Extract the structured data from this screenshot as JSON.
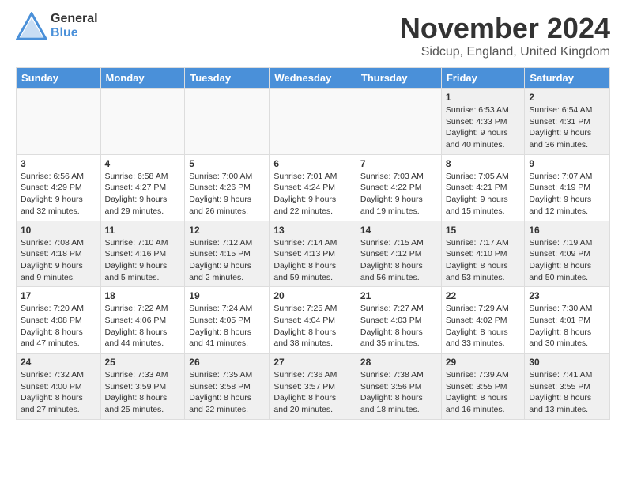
{
  "header": {
    "logo_general": "General",
    "logo_blue": "Blue",
    "month_title": "November 2024",
    "location": "Sidcup, England, United Kingdom"
  },
  "days_of_week": [
    "Sunday",
    "Monday",
    "Tuesday",
    "Wednesday",
    "Thursday",
    "Friday",
    "Saturday"
  ],
  "weeks": [
    [
      {
        "date": "",
        "info": ""
      },
      {
        "date": "",
        "info": ""
      },
      {
        "date": "",
        "info": ""
      },
      {
        "date": "",
        "info": ""
      },
      {
        "date": "",
        "info": ""
      },
      {
        "date": "1",
        "info": "Sunrise: 6:53 AM\nSunset: 4:33 PM\nDaylight: 9 hours and 40 minutes."
      },
      {
        "date": "2",
        "info": "Sunrise: 6:54 AM\nSunset: 4:31 PM\nDaylight: 9 hours and 36 minutes."
      }
    ],
    [
      {
        "date": "3",
        "info": "Sunrise: 6:56 AM\nSunset: 4:29 PM\nDaylight: 9 hours and 32 minutes."
      },
      {
        "date": "4",
        "info": "Sunrise: 6:58 AM\nSunset: 4:27 PM\nDaylight: 9 hours and 29 minutes."
      },
      {
        "date": "5",
        "info": "Sunrise: 7:00 AM\nSunset: 4:26 PM\nDaylight: 9 hours and 26 minutes."
      },
      {
        "date": "6",
        "info": "Sunrise: 7:01 AM\nSunset: 4:24 PM\nDaylight: 9 hours and 22 minutes."
      },
      {
        "date": "7",
        "info": "Sunrise: 7:03 AM\nSunset: 4:22 PM\nDaylight: 9 hours and 19 minutes."
      },
      {
        "date": "8",
        "info": "Sunrise: 7:05 AM\nSunset: 4:21 PM\nDaylight: 9 hours and 15 minutes."
      },
      {
        "date": "9",
        "info": "Sunrise: 7:07 AM\nSunset: 4:19 PM\nDaylight: 9 hours and 12 minutes."
      }
    ],
    [
      {
        "date": "10",
        "info": "Sunrise: 7:08 AM\nSunset: 4:18 PM\nDaylight: 9 hours and 9 minutes."
      },
      {
        "date": "11",
        "info": "Sunrise: 7:10 AM\nSunset: 4:16 PM\nDaylight: 9 hours and 5 minutes."
      },
      {
        "date": "12",
        "info": "Sunrise: 7:12 AM\nSunset: 4:15 PM\nDaylight: 9 hours and 2 minutes."
      },
      {
        "date": "13",
        "info": "Sunrise: 7:14 AM\nSunset: 4:13 PM\nDaylight: 8 hours and 59 minutes."
      },
      {
        "date": "14",
        "info": "Sunrise: 7:15 AM\nSunset: 4:12 PM\nDaylight: 8 hours and 56 minutes."
      },
      {
        "date": "15",
        "info": "Sunrise: 7:17 AM\nSunset: 4:10 PM\nDaylight: 8 hours and 53 minutes."
      },
      {
        "date": "16",
        "info": "Sunrise: 7:19 AM\nSunset: 4:09 PM\nDaylight: 8 hours and 50 minutes."
      }
    ],
    [
      {
        "date": "17",
        "info": "Sunrise: 7:20 AM\nSunset: 4:08 PM\nDaylight: 8 hours and 47 minutes."
      },
      {
        "date": "18",
        "info": "Sunrise: 7:22 AM\nSunset: 4:06 PM\nDaylight: 8 hours and 44 minutes."
      },
      {
        "date": "19",
        "info": "Sunrise: 7:24 AM\nSunset: 4:05 PM\nDaylight: 8 hours and 41 minutes."
      },
      {
        "date": "20",
        "info": "Sunrise: 7:25 AM\nSunset: 4:04 PM\nDaylight: 8 hours and 38 minutes."
      },
      {
        "date": "21",
        "info": "Sunrise: 7:27 AM\nSunset: 4:03 PM\nDaylight: 8 hours and 35 minutes."
      },
      {
        "date": "22",
        "info": "Sunrise: 7:29 AM\nSunset: 4:02 PM\nDaylight: 8 hours and 33 minutes."
      },
      {
        "date": "23",
        "info": "Sunrise: 7:30 AM\nSunset: 4:01 PM\nDaylight: 8 hours and 30 minutes."
      }
    ],
    [
      {
        "date": "24",
        "info": "Sunrise: 7:32 AM\nSunset: 4:00 PM\nDaylight: 8 hours and 27 minutes."
      },
      {
        "date": "25",
        "info": "Sunrise: 7:33 AM\nSunset: 3:59 PM\nDaylight: 8 hours and 25 minutes."
      },
      {
        "date": "26",
        "info": "Sunrise: 7:35 AM\nSunset: 3:58 PM\nDaylight: 8 hours and 22 minutes."
      },
      {
        "date": "27",
        "info": "Sunrise: 7:36 AM\nSunset: 3:57 PM\nDaylight: 8 hours and 20 minutes."
      },
      {
        "date": "28",
        "info": "Sunrise: 7:38 AM\nSunset: 3:56 PM\nDaylight: 8 hours and 18 minutes."
      },
      {
        "date": "29",
        "info": "Sunrise: 7:39 AM\nSunset: 3:55 PM\nDaylight: 8 hours and 16 minutes."
      },
      {
        "date": "30",
        "info": "Sunrise: 7:41 AM\nSunset: 3:55 PM\nDaylight: 8 hours and 13 minutes."
      }
    ]
  ]
}
